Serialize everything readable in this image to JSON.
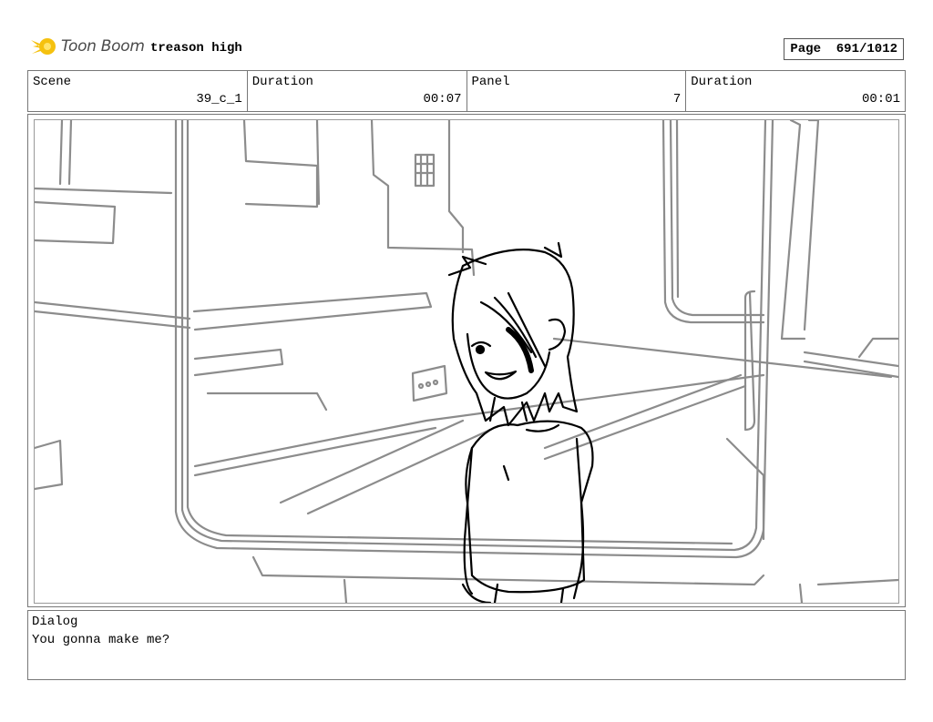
{
  "header": {
    "logo_text": "Toon Boom",
    "project_title": "treason high",
    "page_label": "Page",
    "page_number": "691/1012"
  },
  "info": {
    "scene_label": "Scene",
    "scene_value": "39_c_1",
    "duration_label": "Duration",
    "duration_value": "00:07",
    "panel_label": "Panel",
    "panel_value": "7",
    "panel_duration_label": "Duration",
    "panel_duration_value": "00:01"
  },
  "dialog": {
    "label": "Dialog",
    "text": "You gonna make me?"
  }
}
